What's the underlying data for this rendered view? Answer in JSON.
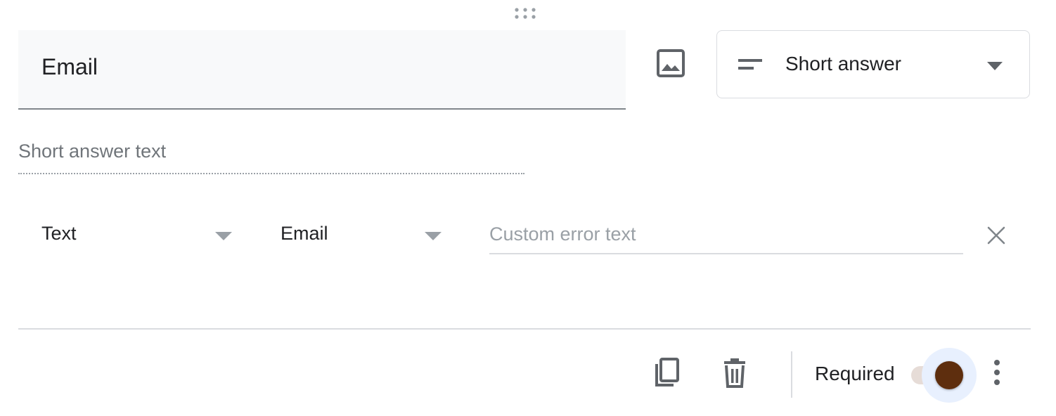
{
  "question": {
    "title": "Email",
    "answer_placeholder": "Short answer text"
  },
  "type_select": {
    "selected": "Short answer",
    "icon": "short-text-icon"
  },
  "validation": {
    "type_value": "Text",
    "rule_value": "Email",
    "error_placeholder": "Custom error text"
  },
  "footer": {
    "required_label": "Required",
    "required_on": true
  },
  "icons": {
    "drag": "drag-handle-icon",
    "image": "image-icon",
    "clear": "close-icon",
    "copy": "copy-icon",
    "delete": "trash-icon",
    "more": "more-vert-icon"
  },
  "colors": {
    "toggle_knob": "#5e2e0e",
    "toggle_track": "#e6dcd7",
    "toggle_halo": "#e8f0fe",
    "field_background": "#f8f9fa"
  }
}
